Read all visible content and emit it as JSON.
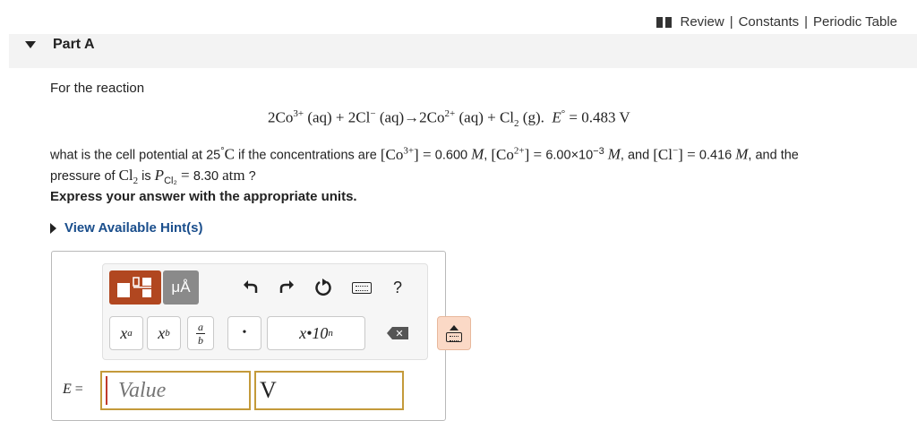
{
  "top_links": {
    "review": "Review",
    "sep1": "|",
    "constants": "Constants",
    "sep2": "|",
    "periodic_table": "Periodic Table"
  },
  "part": {
    "title": "Part A"
  },
  "question": {
    "intro": "For the reaction",
    "equation": {
      "coef1": "2Co",
      "ch1": "3+",
      "s1": " (aq) + 2Cl",
      "ch2": "−",
      "s2": " (aq)→2Co",
      "ch3": "2+",
      "s3": " (aq) + Cl",
      "sub1": "2",
      "s4": " (g).",
      "e": "E",
      "deg": "°",
      "value": " = 0.483 V"
    },
    "line1": {
      "t1": "what is the cell potential at 25",
      "deg": "°",
      "c": "C",
      "t2": " if the concentrations are ",
      "co3": "[Co",
      "co3_ch": "3+",
      "co3_end": "]",
      "eq1": " = ",
      "v1": "0.600 ",
      "M1": "M",
      "comma1": ", ",
      "co2": "[Co",
      "co2_ch": "2+",
      "co2_end": "]",
      "eq2": " = ",
      "v2": "6.00×10",
      "v2_exp": "−3",
      "sp": " ",
      "M2": "M",
      "comma2": ", and ",
      "cl": "[Cl",
      "cl_ch": "−",
      "cl_end": "]",
      "eq3": " = ",
      "v3": "0.416 ",
      "M3": "M",
      "t3": ", and the"
    },
    "line2": {
      "t1": "pressure of ",
      "cl2": "Cl",
      "cl2_sub": "2",
      "t2": " is ",
      "p": "P",
      "p_sub": "Cl₂",
      "eq": " = ",
      "v": "8.30 ",
      "unit": "atm",
      "end": " ?"
    },
    "express": "Express your answer with the appropriate units.",
    "hints": "View Available Hint(s)"
  },
  "toolbar": {
    "units_label": "μÅ",
    "help_label": "?",
    "key_power_base": "x",
    "key_power_exp": "a",
    "key_sub_base": "x",
    "key_sub_sub": "b",
    "key_frac_num": "a",
    "key_frac_den": "b",
    "key_dot": "•",
    "key_sci": "x•10",
    "key_sci_exp": "n",
    "delete_label": "✕"
  },
  "answer": {
    "label_var": "E",
    "label_eq": " =",
    "placeholder": "Value",
    "unit_value": "V"
  }
}
